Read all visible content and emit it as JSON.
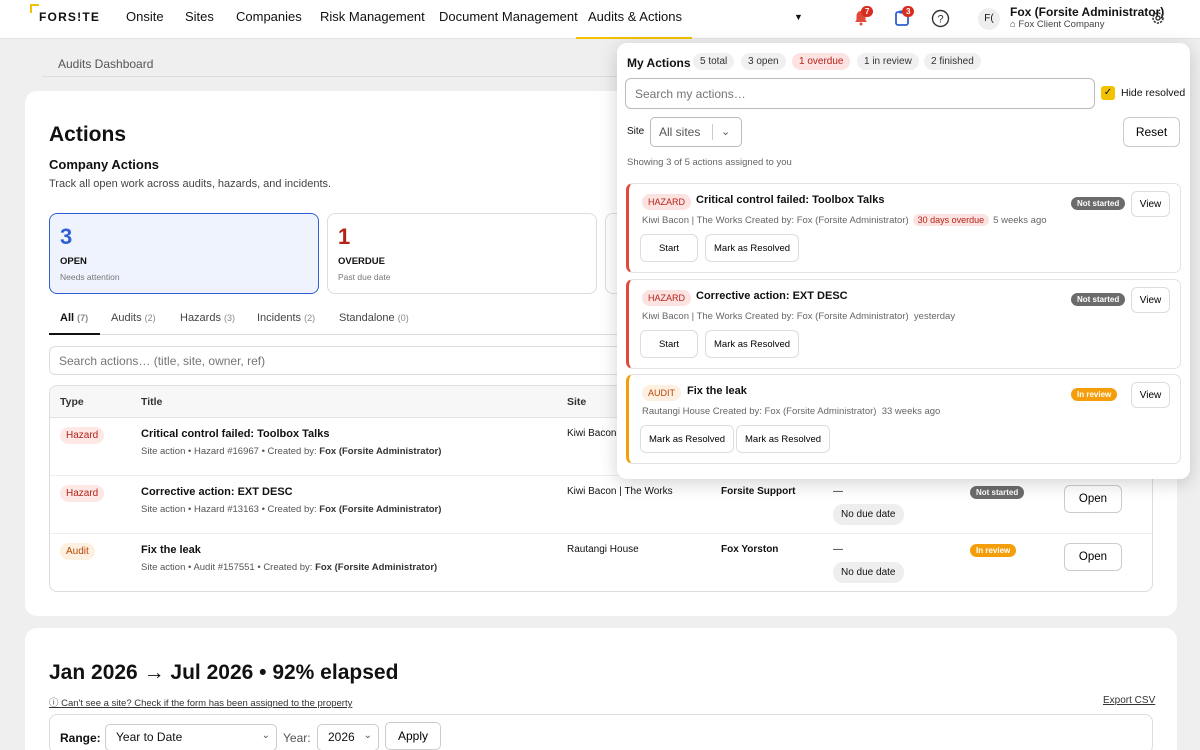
{
  "nav": {
    "logo": "FORS!TE",
    "items": [
      "Onsite",
      "Sites",
      "Companies",
      "Risk Management",
      "Document Management",
      "Audits & Actions"
    ],
    "notifications_count": "7",
    "tasks_count": "3",
    "user_initials": "F(",
    "user_name": "Fox (Forsite Administrator)",
    "user_company": "Fox Client Company"
  },
  "breadcrumb": "Audits Dashboard",
  "page": {
    "title": "Actions",
    "subtitle": "Company Actions",
    "description": "Track all open work across audits, hazards, and incidents."
  },
  "stats": [
    {
      "value": "3",
      "label": "OPEN",
      "hint": "Needs attention",
      "color": "#2f5fd1"
    },
    {
      "value": "1",
      "label": "OVERDUE",
      "hint": "Past due date",
      "color": "#b42318"
    }
  ],
  "tabs": [
    {
      "label": "All",
      "count": "(7)"
    },
    {
      "label": "Audits",
      "count": "(2)"
    },
    {
      "label": "Hazards",
      "count": "(3)"
    },
    {
      "label": "Incidents",
      "count": "(2)"
    },
    {
      "label": "Standalone",
      "count": "(0)"
    }
  ],
  "search_placeholder": "Search actions… (title, site, owner, ref)",
  "table": {
    "headers": {
      "type": "Type",
      "title": "Title",
      "site": "Site"
    },
    "rows": [
      {
        "type": "Hazard",
        "title": "Critical control failed: Toolbox Talks",
        "meta": "Site action  •  Hazard #16967  •  Created by:",
        "creator": "Fox (Forsite Administrator)",
        "site": "Kiwi Bacon",
        "owner": "",
        "due": "",
        "no_due": "",
        "status": "",
        "open": ""
      },
      {
        "type": "Hazard",
        "title": "Corrective action: EXT DESC",
        "meta": "Site action  •  Hazard #13163  •  Created by:",
        "creator": "Fox (Forsite Administrator)",
        "site": "Kiwi Bacon | The Works",
        "owner": "Forsite Support",
        "due": "—",
        "no_due": "No due date",
        "status": "Not started",
        "open": "Open"
      },
      {
        "type": "Audit",
        "title": "Fix the leak",
        "meta": "Site action  •  Audit #157551  •  Created by:",
        "creator": "Fox (Forsite Administrator)",
        "site": "Rautangi House",
        "owner": "Fox Yorston",
        "due": "—",
        "no_due": "No due date",
        "status": "In review",
        "open": "Open"
      }
    ]
  },
  "range": {
    "title": "Jan 2026 → Jul 2026 • 92% elapsed",
    "hint": "Can't see a site? Check if the form has been assigned to the property",
    "export": "Export CSV",
    "range_label": "Range:",
    "range_value": "Year to Date",
    "year_label": "Year:",
    "year_value": "2026",
    "apply": "Apply"
  },
  "my_actions": {
    "title": "My Actions",
    "chips": [
      "5 total",
      "3 open",
      "1 overdue",
      "1 in review",
      "2 finished"
    ],
    "search_placeholder": "Search my actions…",
    "hide_resolved": "Hide resolved",
    "site_label": "Site",
    "site_value": "All sites",
    "reset": "Reset",
    "showing": "Showing 3 of 5 actions assigned to you",
    "items": [
      {
        "type": "HAZARD",
        "title": "Critical control failed: Toolbox Talks",
        "meta_a": "Kiwi Bacon | The Works   Created by: Fox (Forsite Administrator)",
        "overdue": "30 days overdue",
        "meta_b": "5 weeks ago",
        "status": "Not started",
        "view": "View",
        "btn1": "Start",
        "btn2": "Mark as Resolved"
      },
      {
        "type": "HAZARD",
        "title": "Corrective action: EXT DESC",
        "meta_a": "Kiwi Bacon | The Works   Created by: Fox (Forsite Administrator)",
        "overdue": "",
        "meta_b": "yesterday",
        "status": "Not started",
        "view": "View",
        "btn1": "Start",
        "btn2": "Mark as Resolved"
      },
      {
        "type": "AUDIT",
        "title": "Fix the leak",
        "meta_a": "Rautangi House   Created by: Fox (Forsite Administrator)",
        "overdue": "",
        "meta_b": "33 weeks ago",
        "status": "In review",
        "view": "View",
        "btn1": "Mark as Resolved",
        "btn2": "Mark as Resolved"
      }
    ]
  }
}
